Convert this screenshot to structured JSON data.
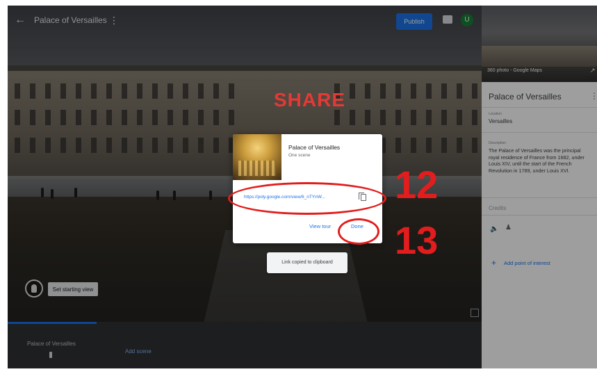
{
  "topbar": {
    "back_icon": "arrow-left-icon",
    "title": "Palace of Versailles",
    "more_icon": "more-vert-icon",
    "publish_label": "Publish",
    "comment_icon": "comment-icon",
    "avatar_initial": "U"
  },
  "scene_controls": {
    "set_starting_view_label": "Set starting view",
    "fullscreen_icon": "fullscreen-icon"
  },
  "filmstrip": {
    "scene_label": "Palace of Versailles",
    "add_scene_label": "Add scene"
  },
  "sidebar": {
    "preview_caption": "360 photo - Google Maps",
    "title": "Palace of Versailles",
    "menu_icon": "more-vert-icon",
    "location_label": "Location",
    "location_value": "Versailles",
    "description_label": "Description",
    "description": "The Palace of Versailles was the principal royal residence of France from 1682, under Louis XIV, until the start of the French Revolution in 1789, under Louis XVI.",
    "credits_label": "Credits",
    "add_poi_label": "Add point of interest"
  },
  "share_dialog": {
    "heading": "SHARE",
    "tour_title": "Palace of Versailles",
    "scene_count": "One scene",
    "link": "https://poly.google.com/view/6_nTYnW...",
    "view_tour_label": "View tour",
    "done_label": "Done"
  },
  "annotations": {
    "step_link": "12",
    "step_done": "13"
  },
  "toast": {
    "message": "Link copied to clipboard"
  },
  "colors": {
    "accent": "#1a73e8",
    "annotation_red": "#e21d1d"
  }
}
